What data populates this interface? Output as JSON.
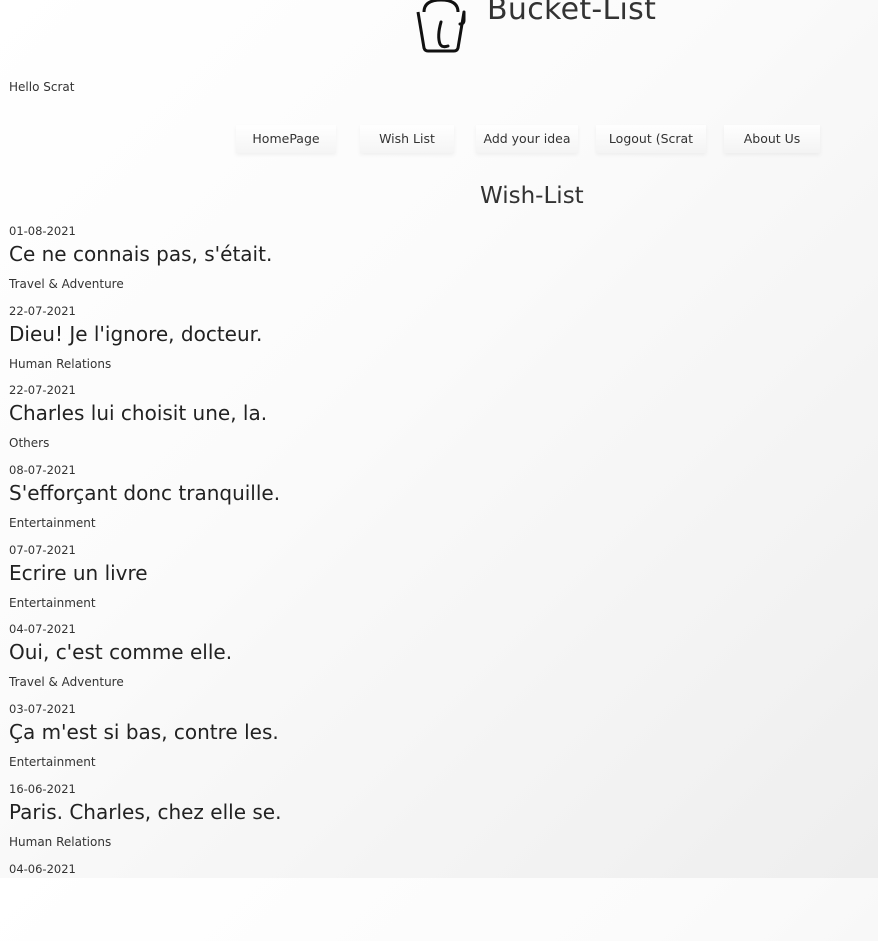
{
  "header": {
    "title": "Bucket-List",
    "logo_icon": "bucket-icon"
  },
  "greeting": "Hello Scrat",
  "nav": {
    "items": [
      {
        "label": "HomePage"
      },
      {
        "label": "Wish List"
      },
      {
        "label": "Add your idea"
      },
      {
        "label": "Logout (Scrat"
      },
      {
        "label": "About Us"
      }
    ]
  },
  "main": {
    "heading": "Wish-List",
    "wishes": [
      {
        "date": "01-08-2021",
        "title": "Ce ne connais pas, s'était.",
        "category": "Travel & Adventure"
      },
      {
        "date": "22-07-2021",
        "title": "Dieu! Je l'ignore, docteur.",
        "category": "Human Relations"
      },
      {
        "date": "22-07-2021",
        "title": "Charles lui choisit une, la.",
        "category": "Others"
      },
      {
        "date": "08-07-2021",
        "title": "S'efforçant donc tranquille.",
        "category": "Entertainment"
      },
      {
        "date": "07-07-2021",
        "title": "Ecrire un livre",
        "category": "Entertainment"
      },
      {
        "date": "04-07-2021",
        "title": "Oui, c'est comme elle.",
        "category": "Travel & Adventure"
      },
      {
        "date": "03-07-2021",
        "title": "Ça m'est si bas, contre les.",
        "category": "Entertainment"
      },
      {
        "date": "16-06-2021",
        "title": "Paris. Charles, chez elle se.",
        "category": "Human Relations"
      },
      {
        "date": "04-06-2021",
        "title": "",
        "category": ""
      }
    ]
  }
}
